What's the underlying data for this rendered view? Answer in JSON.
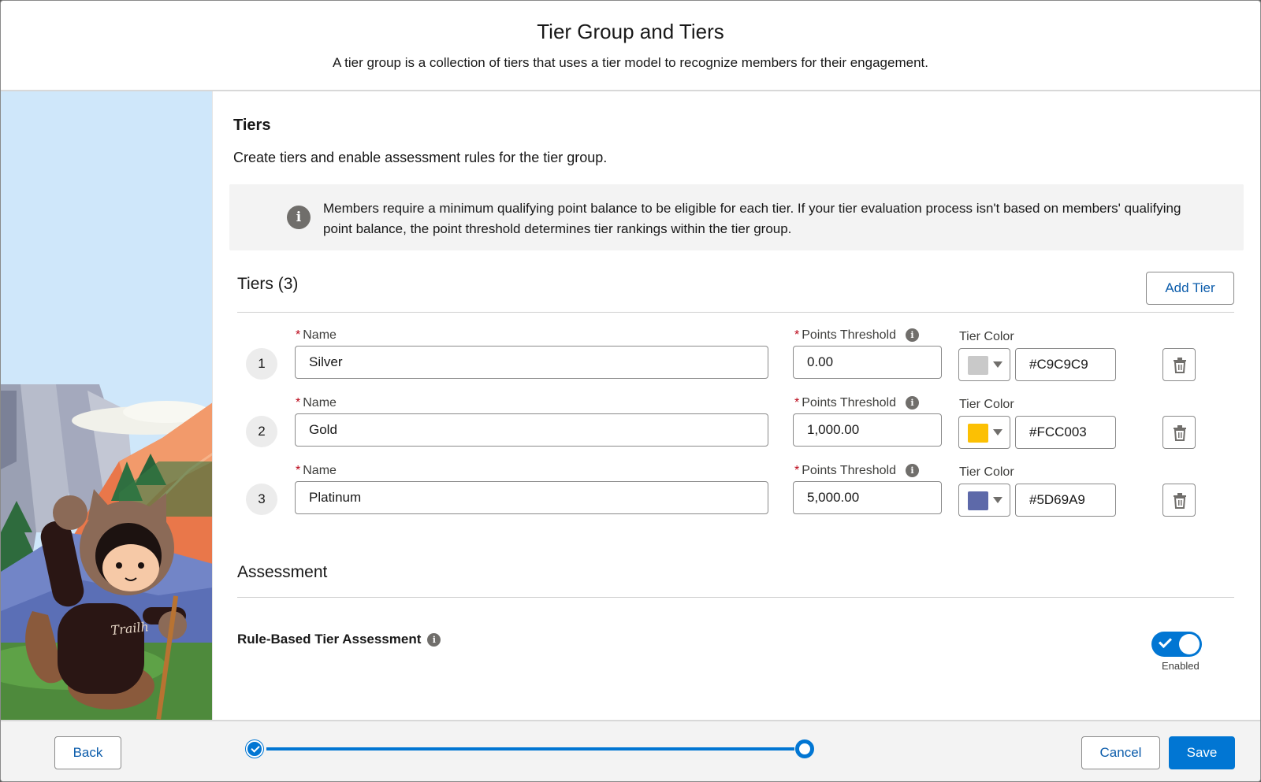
{
  "header": {
    "title": "Tier Group and Tiers",
    "subtitle": "A tier group is a collection of tiers that uses a tier model to recognize members for their engagement."
  },
  "section": {
    "title": "Tiers",
    "description": "Create tiers and enable assessment rules for the tier group."
  },
  "info_box": {
    "text": "Members require a minimum qualifying point balance to be eligible for each tier. If your tier evaluation process isn't based on members' qualifying point balance, the point threshold determines tier rankings within the tier group."
  },
  "tiers_block": {
    "title": "Tiers (3)",
    "add_button": "Add Tier",
    "name_label": "Name",
    "threshold_label": "Points Threshold",
    "color_label": "Tier Color",
    "items": [
      {
        "number": "1",
        "name": "Silver",
        "threshold": "0.00",
        "color": "#C9C9C9"
      },
      {
        "number": "2",
        "name": "Gold",
        "threshold": "1,000.00",
        "color": "#FCC003"
      },
      {
        "number": "3",
        "name": "Platinum",
        "threshold": "5,000.00",
        "color": "#5D69A9"
      }
    ]
  },
  "assessment": {
    "title": "Assessment",
    "rule_label": "Rule-Based Tier Assessment",
    "toggle_state": "Enabled",
    "toggle_on": true
  },
  "footer": {
    "back": "Back",
    "cancel": "Cancel",
    "save": "Save",
    "progress_steps": 2,
    "current_step": 2
  },
  "colors": {
    "brand": "#0176d3",
    "link": "#0b5cab",
    "required": "#ba0517",
    "sky": "#cfe7fa"
  },
  "icons": [
    "info-icon",
    "trash-icon",
    "chevron-down-icon",
    "check-icon"
  ]
}
